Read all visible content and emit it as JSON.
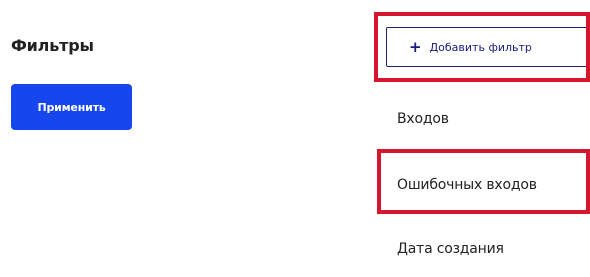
{
  "filters_panel": {
    "title": "Фильтры",
    "apply_label": "Применить"
  },
  "add_filter": {
    "icon": "plus-icon",
    "icon_glyph": "+",
    "label": "Добавить фильтр"
  },
  "filter_options": [
    {
      "label": "Входов"
    },
    {
      "label": "Ошибочных входов"
    },
    {
      "label": "Дата создания"
    }
  ],
  "colors": {
    "primary": "#1546ee",
    "highlight": "#d4172e",
    "add_filter_text": "#1a1a80"
  }
}
